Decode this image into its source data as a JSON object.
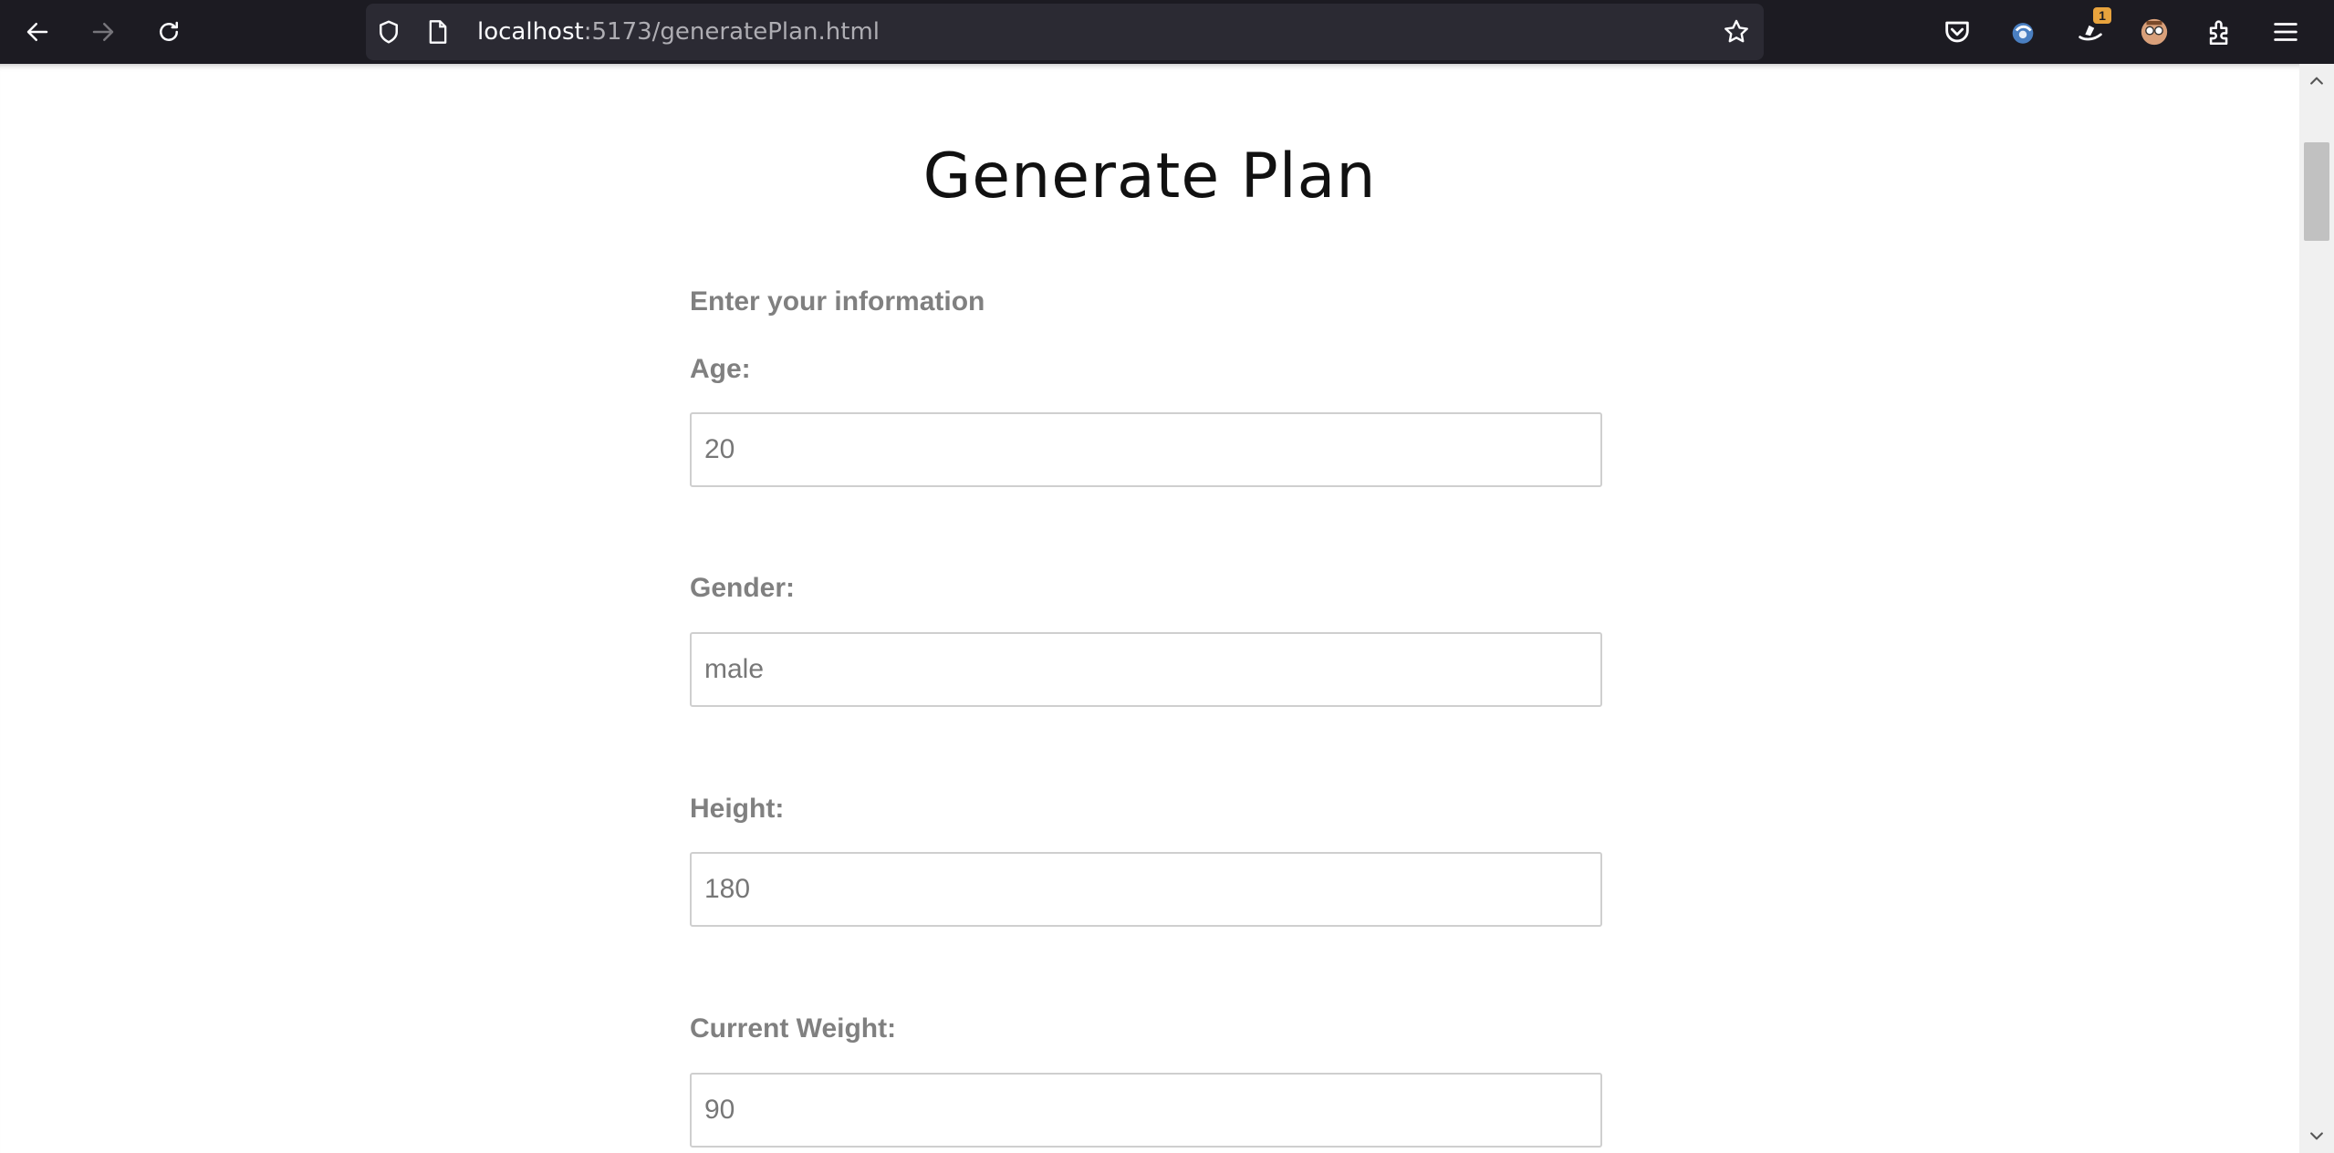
{
  "browser": {
    "url_host": "localhost",
    "url_rest": ":5173/generatePlan.html",
    "extension_badge": "1",
    "icons": [
      "back-icon",
      "forward-icon",
      "reload-icon",
      "shield-icon",
      "page-icon",
      "bookmark-star-icon",
      "pocket-icon",
      "extension-icon",
      "extension-badge-icon",
      "avatar-icon",
      "extensions-puzzle-icon",
      "menu-icon"
    ]
  },
  "page": {
    "title": "Generate Plan",
    "subtitle": "Enter your information",
    "fields": [
      {
        "label": "Age:",
        "value": "20"
      },
      {
        "label": "Gender:",
        "value": "male"
      },
      {
        "label": "Height:",
        "value": "180"
      },
      {
        "label": "Current Weight:",
        "value": "90"
      }
    ]
  },
  "colors": {
    "toolbar_bg": "#1c1b22",
    "urlbar_bg": "#2b2a33",
    "label_gray": "#808080",
    "input_border": "#cfcfcf"
  }
}
